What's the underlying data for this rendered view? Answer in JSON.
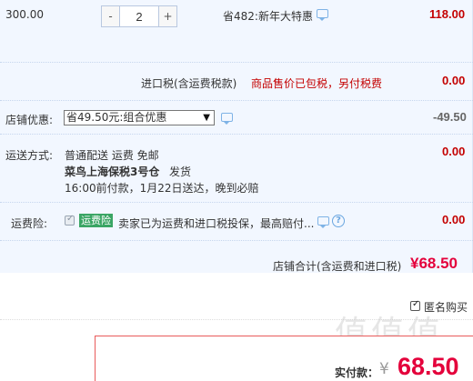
{
  "item": {
    "unit_price": "300.00",
    "quantity": "2",
    "minus": "-",
    "plus": "+",
    "promo": "省482:新年大特惠",
    "subtotal": "118.00"
  },
  "tax": {
    "label": "进口税(含运费税款)",
    "note": "商品售价已包税，另付税费",
    "value": "0.00"
  },
  "shop_discount": {
    "label": "店铺优惠:",
    "selected": "省49.50元:组合优惠",
    "arrow": "▼",
    "value": "-49.50"
  },
  "shipping": {
    "label": "运送方式:",
    "method": "普通配送 运费 免邮",
    "warehouse": "菜鸟上海保税3号仓",
    "dispatch": "发货",
    "eta": "16:00前付款，1月22日送达，晚到必赔",
    "value": "0.00"
  },
  "insurance": {
    "label": "运费险:",
    "badge": "运费险",
    "text": "卖家已为运费和进口税投保，最高赔付...",
    "help": "?",
    "value": "0.00"
  },
  "shop_total": {
    "label": "店铺合计(含运费和进口税)",
    "value": "¥68.50"
  },
  "anonymous": {
    "label": "匿名购买"
  },
  "payment": {
    "label": "实付款：",
    "currency": "¥",
    "value": "68.50"
  },
  "watermark": "值值值"
}
